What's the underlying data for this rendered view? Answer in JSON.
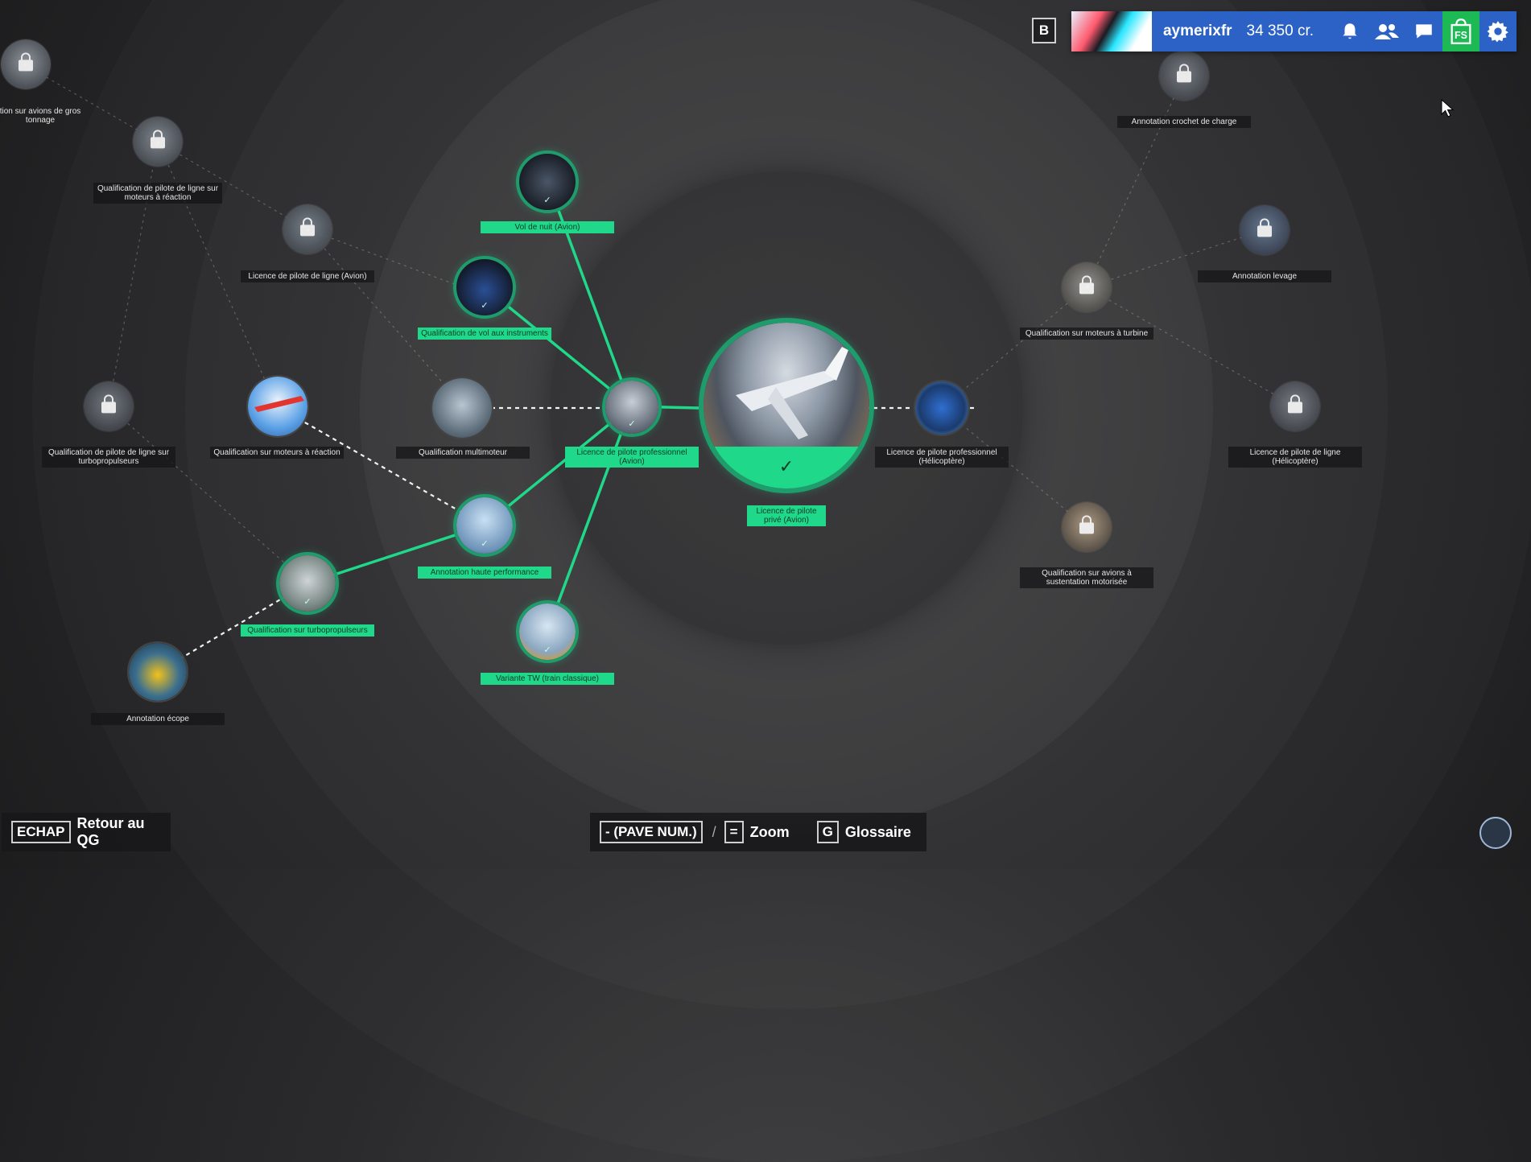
{
  "topbar": {
    "b_key": "B",
    "avatar": "avatar-image",
    "username": "aymerixfr",
    "credits": "34 350 cr.",
    "icons": [
      "bell-icon",
      "friends-icon",
      "chat-icon",
      "store-icon",
      "gear-icon"
    ],
    "store_text": "FS",
    "colors": {
      "bar": "#2c62c6",
      "store": "#1db954"
    }
  },
  "nodes": {
    "center": {
      "label": "Licence de pilote privé (Avion)",
      "state": "completed"
    },
    "cpl_avion": {
      "label": "Licence de pilote professionnel (Avion)",
      "state": "completed"
    },
    "vol_nuit": {
      "label": "Vol de nuit (Avion)",
      "state": "completed"
    },
    "ifr": {
      "label": "Qualification de vol aux instruments",
      "state": "completed"
    },
    "haute_perf": {
      "label": "Annotation haute performance",
      "state": "completed"
    },
    "tw": {
      "label": "Variante TW (train classique)",
      "state": "completed"
    },
    "turboprop": {
      "label": "Qualification sur turbopropulseurs",
      "state": "completed"
    },
    "multimoteur": {
      "label": "Qualification multimoteur",
      "state": "available"
    },
    "reaction": {
      "label": "Qualification sur moteurs à réaction",
      "state": "available"
    },
    "ecope": {
      "label": "Annotation écope",
      "state": "available"
    },
    "cpl_helico": {
      "label": "Licence de pilote professionnel (Hélicoptère)",
      "state": "available"
    },
    "atpl_avion": {
      "label": "Licence de pilote de ligne (Avion)",
      "state": "locked"
    },
    "atpl_reaction": {
      "label": "Qualification de pilote de ligne sur moteurs à réaction",
      "state": "locked"
    },
    "gros_tonnage": {
      "label": "tion sur avions de gros tonnage",
      "state": "locked"
    },
    "atpl_turboprop": {
      "label": "Qualification de pilote de ligne sur turbopropulseurs",
      "state": "locked"
    },
    "turbine": {
      "label": "Qualification sur moteurs à turbine",
      "state": "locked"
    },
    "crochet": {
      "label": "Annotation crochet de charge",
      "state": "locked"
    },
    "levage": {
      "label": "Annotation levage",
      "state": "locked"
    },
    "atpl_helico": {
      "label": "Licence de pilote de ligne (Hélicoptère)",
      "state": "locked"
    },
    "sustentation": {
      "label": "Qualification sur avions à sustentation motorisée",
      "state": "locked"
    }
  },
  "bottombar": {
    "echap_key": "ECHAP",
    "echap_label": "Retour au QG",
    "zoom_out_key": "- (PAVE NUM.)",
    "zoom_sep": "/",
    "zoom_in_key": "=",
    "zoom_label": "Zoom",
    "glossary_key": "G",
    "glossary_label": "Glossaire"
  },
  "colors": {
    "completed": "#1fd88a",
    "edge_completed": "#1fd88a",
    "edge_locked": "#bbbbbb"
  }
}
